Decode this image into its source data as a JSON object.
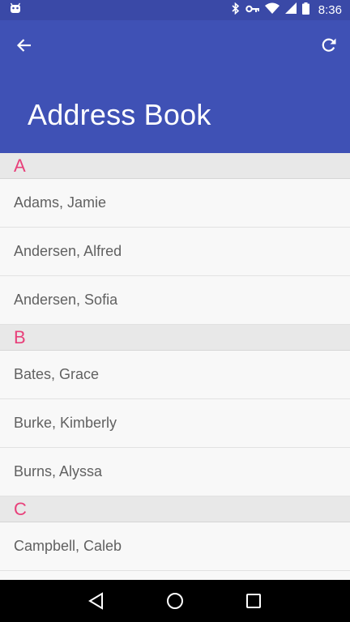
{
  "status_bar": {
    "time": "8:36",
    "icons": [
      "android-debug-icon",
      "bluetooth-icon",
      "vpn-key-icon",
      "wifi-icon",
      "signal-icon",
      "battery-icon"
    ]
  },
  "app_bar": {
    "title": "Address Book",
    "back_icon": "arrow-back-icon",
    "refresh_icon": "refresh-icon",
    "color": "#3f51b5"
  },
  "accent_color": "#e8407a",
  "contacts": {
    "sections": [
      {
        "letter": "A",
        "items": [
          "Adams, Jamie",
          "Andersen, Alfred",
          "Andersen, Sofia"
        ]
      },
      {
        "letter": "B",
        "items": [
          "Bates, Grace",
          "Burke, Kimberly",
          "Burns, Alyssa"
        ]
      },
      {
        "letter": "C",
        "items": [
          "Campbell, Caleb",
          ""
        ]
      }
    ]
  },
  "nav_bar": {
    "icons": [
      "back-triangle-icon",
      "home-circle-icon",
      "recents-square-icon"
    ]
  }
}
